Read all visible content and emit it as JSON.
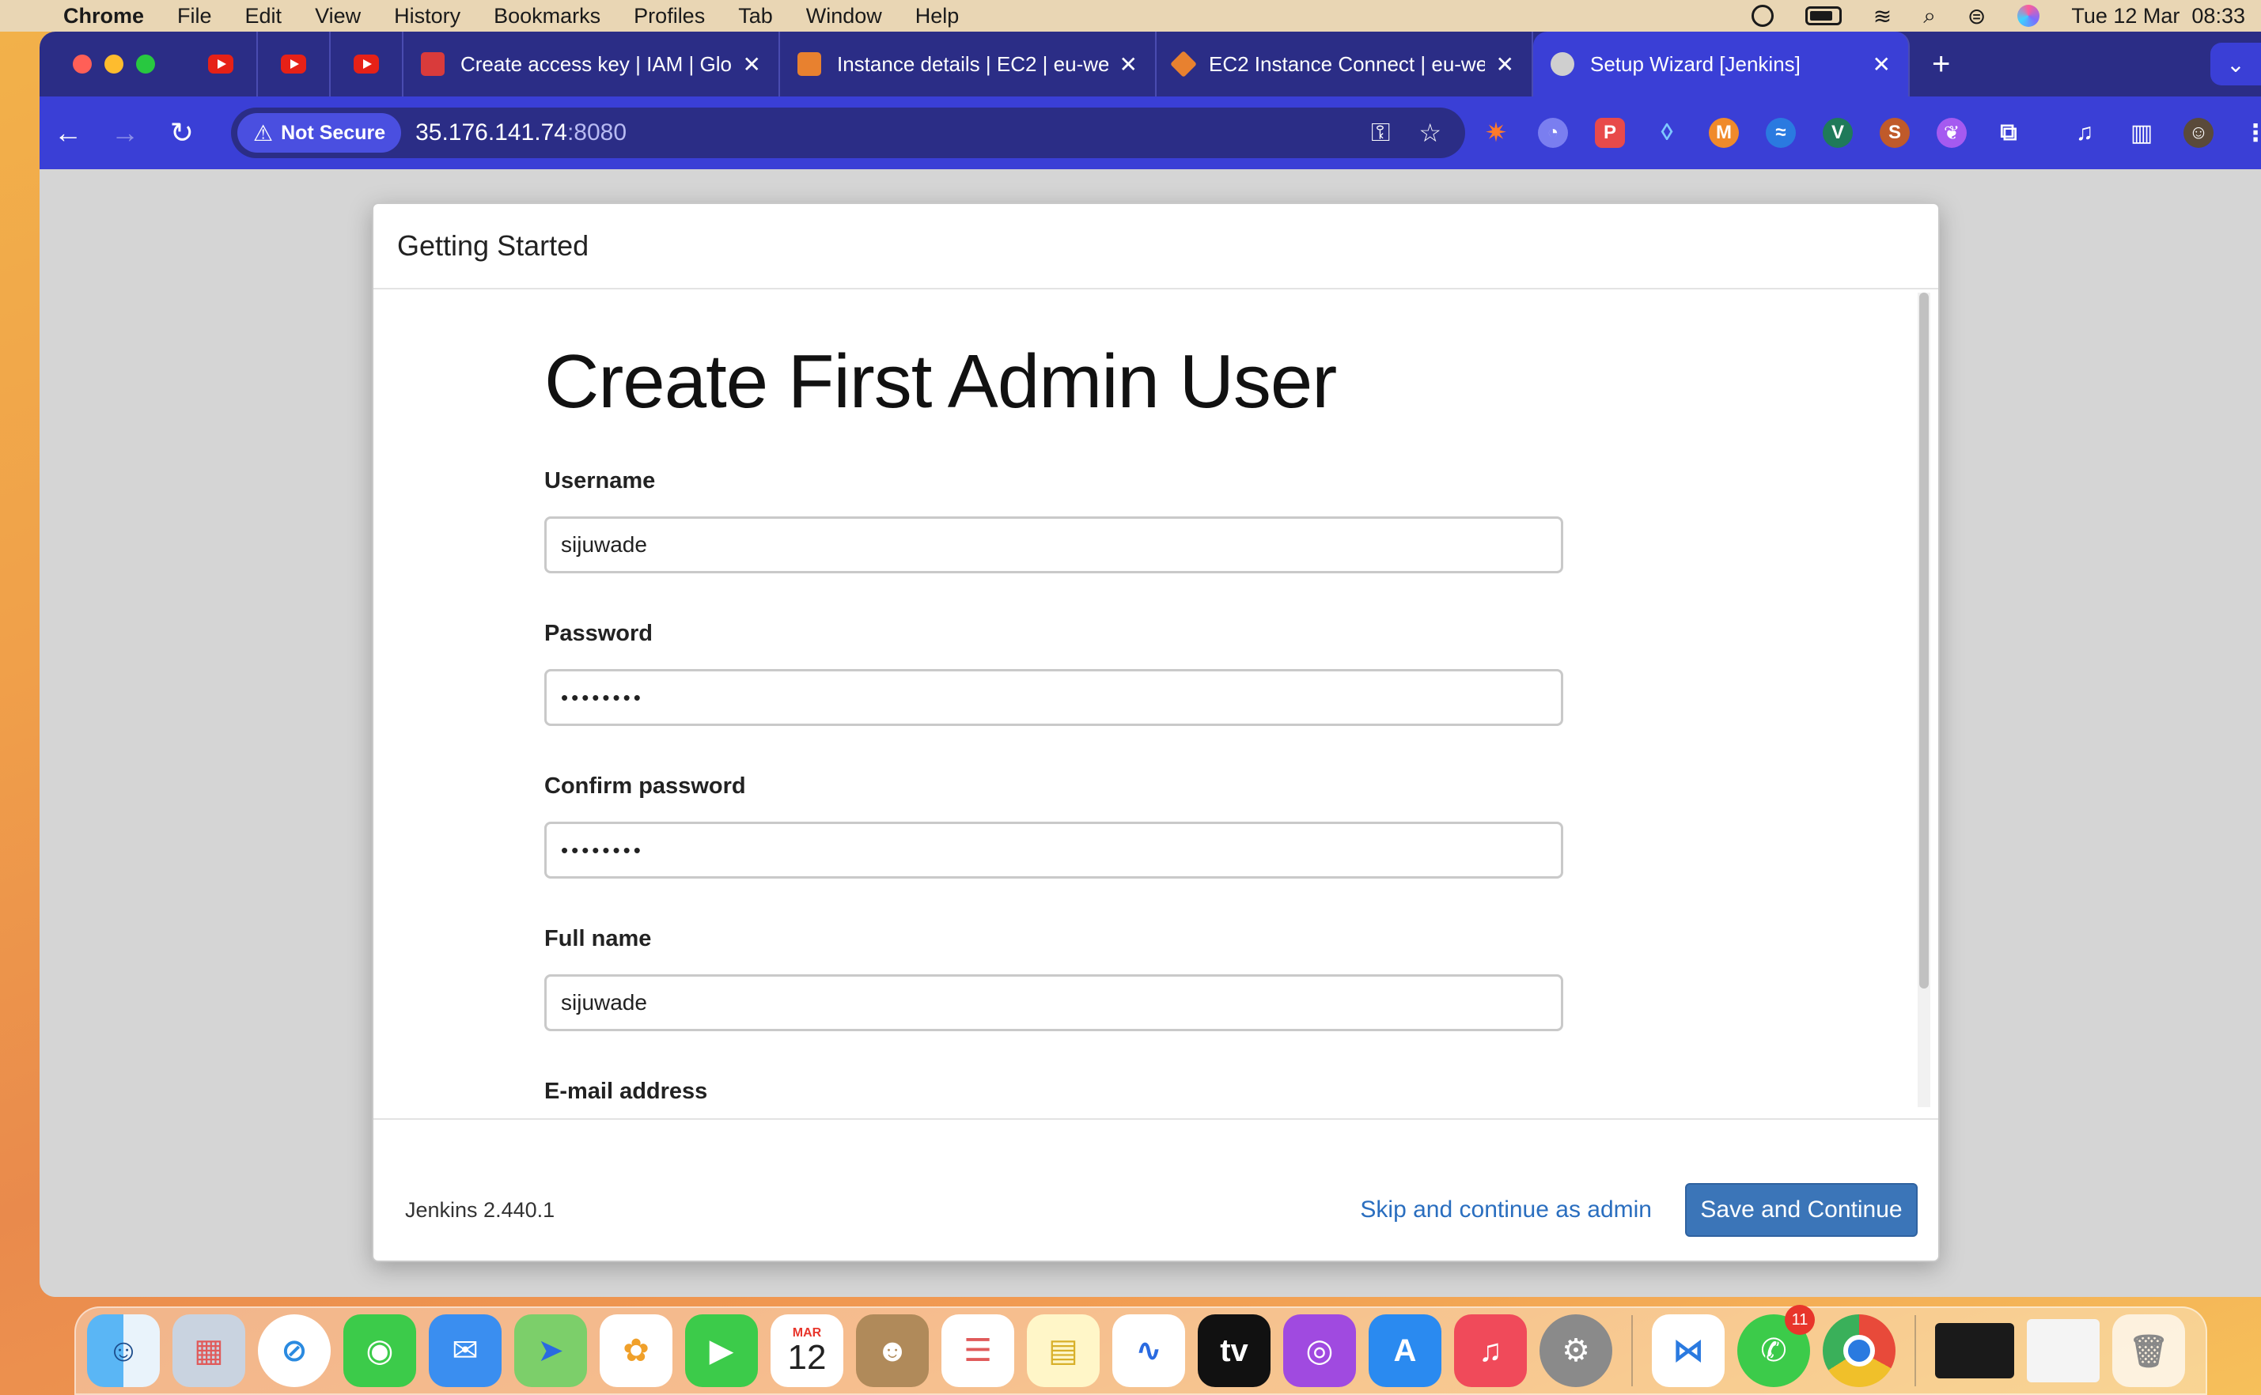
{
  "menubar": {
    "app_name": "Chrome",
    "items": [
      "File",
      "Edit",
      "View",
      "History",
      "Bookmarks",
      "Profiles",
      "Tab",
      "Window",
      "Help"
    ],
    "datetime": "Tue 12 Mar  08:33"
  },
  "tabs": [
    {
      "title": "Create access key | IAM | Glob",
      "favicon_color": "#d93b3b"
    },
    {
      "title": "Instance details | EC2 | eu-we",
      "favicon_color": "#e8812f"
    },
    {
      "title": "EC2 Instance Connect | eu-we",
      "favicon_color": "#e8812f"
    },
    {
      "title": "Setup Wizard [Jenkins]",
      "favicon_color": "#cfcfcf"
    }
  ],
  "omnibox": {
    "security_label": "Not Secure",
    "host": "35.176.141.74",
    "port": ":8080"
  },
  "dialog": {
    "header": "Getting Started",
    "heading": "Create First Admin User",
    "fields": [
      {
        "label": "Username",
        "value": "sijuwade"
      },
      {
        "label": "Password",
        "value": "••••••••"
      },
      {
        "label": "Confirm password",
        "value": "••••••••"
      },
      {
        "label": "Full name",
        "value": "sijuwade"
      },
      {
        "label": "E-mail address",
        "value": ""
      }
    ],
    "version": "Jenkins 2.440.1",
    "skip_label": "Skip and continue as admin",
    "save_label": "Save and Continue"
  },
  "dock": {
    "calendar_month": "MAR",
    "calendar_day": "12",
    "whatsapp_badge": "11"
  },
  "colors": {
    "tabstrip": "#2b2d86",
    "toolbar": "#3a3fd6",
    "jenkins_button": "#3b75b8",
    "link": "#2a6ebf"
  }
}
